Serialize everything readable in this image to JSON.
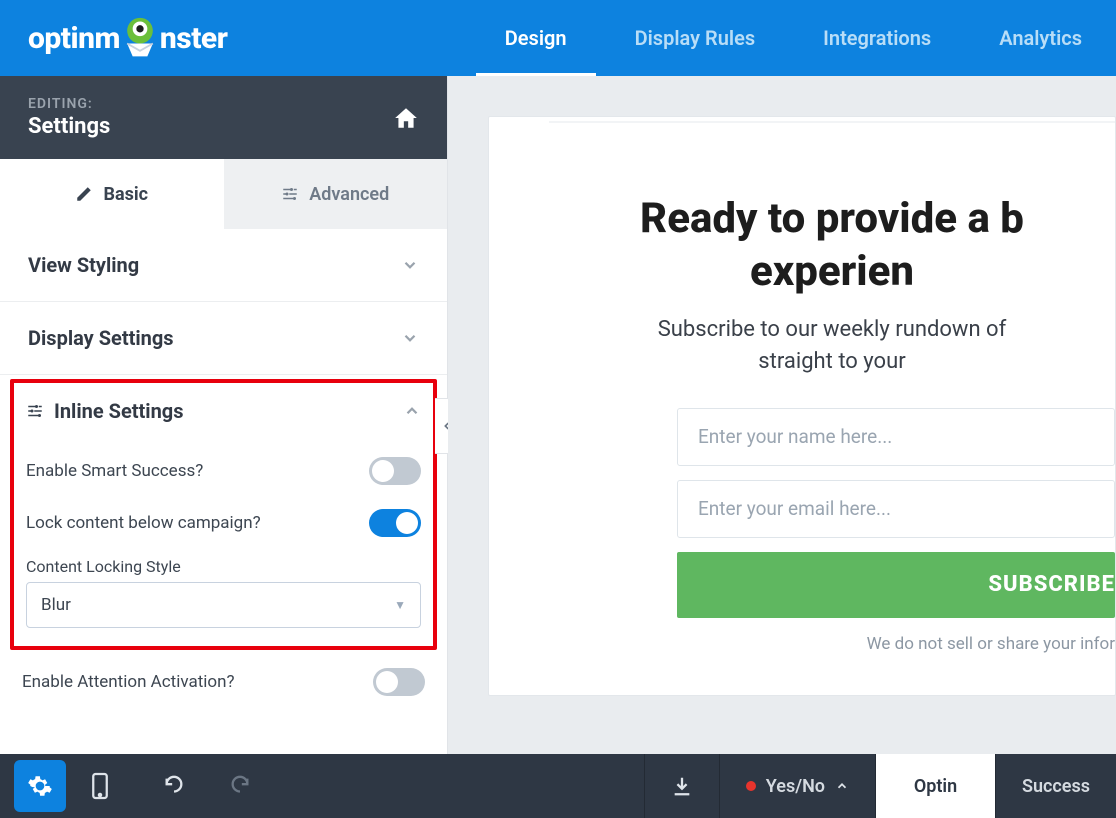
{
  "logo": {
    "pre": "optinm",
    "post": "nster"
  },
  "topNav": {
    "design": "Design",
    "displayRules": "Display Rules",
    "integrations": "Integrations",
    "analytics": "Analytics"
  },
  "sidebar": {
    "editingLabel": "EDITING:",
    "title": "Settings",
    "tabs": {
      "basic": "Basic",
      "advanced": "Advanced"
    },
    "sections": {
      "viewStyling": "View Styling",
      "displaySettings": "Display Settings",
      "inlineSettings": "Inline Settings"
    },
    "inline": {
      "smartSuccess": "Enable Smart Success?",
      "lockContent": "Lock content below campaign?",
      "lockStyleLabel": "Content Locking Style",
      "lockStyleValue": "Blur"
    },
    "attentionActivation": "Enable Attention Activation?"
  },
  "preview": {
    "titleLine1": "Ready to provide a b",
    "titleLine2": "experien",
    "sub1": "Subscribe to our weekly rundown of",
    "sub2": "straight to your",
    "namePlaceholder": "Enter your name here...",
    "emailPlaceholder": "Enter your email here...",
    "cta": "SUBSCRIBE",
    "disclaimer": "We do not sell or share your infor"
  },
  "bottomBar": {
    "yesNo": "Yes/No",
    "optin": "Optin",
    "success": "Success"
  }
}
